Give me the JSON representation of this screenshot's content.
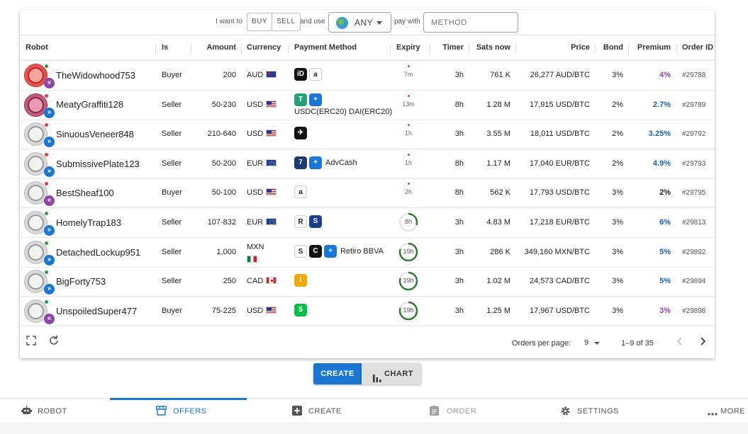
{
  "filter": {
    "want_label": "I want to",
    "buy_label": "BUY",
    "sell_label": "SELL",
    "use_label": "and use",
    "currency_value": "ANY",
    "pay_label": "pay with",
    "method_placeholder": "METHOD"
  },
  "columns": [
    "Robot",
    "Is",
    "Amount",
    "Currency",
    "Payment Method",
    "Expiry",
    "Timer",
    "Sats now",
    "Price",
    "Bond",
    "Premium",
    "Order ID"
  ],
  "rows": [
    {
      "robot": "TheWidowhood753",
      "is": "Buyer",
      "amount": "200",
      "currency": "AUD",
      "flag": "au",
      "avatar": "red",
      "status": "green",
      "side": "buy",
      "methods": [
        {
          "icon": "instant-sepa-icon",
          "color": "#111",
          "glyph": "iD"
        },
        {
          "icon": "amazon-icon",
          "color": "#ffffff",
          "glyph": "a"
        }
      ],
      "method_text": "",
      "expiry": "7m",
      "expiry_type": "text",
      "timer": "3h",
      "sats": "761 K",
      "price": "26,277 AUD/BTC",
      "bond": "3%",
      "premium": "4%",
      "premium_color": "#8e44ad",
      "order_id": "#29788"
    },
    {
      "robot": "MeatyGraffiti128",
      "is": "Seller",
      "amount": "50-230",
      "currency": "USD",
      "flag": "us",
      "avatar": "pink",
      "status": "red",
      "side": "sell",
      "methods": [
        {
          "icon": "tether-icon",
          "color": "#26a17b",
          "glyph": "T"
        },
        {
          "icon": "dai-icon",
          "color": "#1976d2",
          "glyph": "+"
        }
      ],
      "method_text": "USDC(ERC20) DAI(ERC20)",
      "expiry": "13m",
      "expiry_type": "text",
      "timer": "8h",
      "sats": "1.28 M",
      "price": "17,915 USD/BTC",
      "bond": "2%",
      "premium": "2.7%",
      "premium_color": "#1a5fa8",
      "order_id": "#29789"
    },
    {
      "robot": "SinuousVeneer848",
      "is": "Seller",
      "amount": "210-640",
      "currency": "USD",
      "flag": "us",
      "avatar": "gray",
      "status": "red",
      "side": "sell",
      "methods": [
        {
          "icon": "cashapp-icon",
          "color": "#111",
          "glyph": "✈"
        }
      ],
      "method_text": "",
      "expiry": "1h",
      "expiry_type": "text",
      "timer": "3h",
      "sats": "3.55 M",
      "price": "18,011 USD/BTC",
      "bond": "2%",
      "premium": "3.25%",
      "premium_color": "#1a5fa8",
      "order_id": "#29792"
    },
    {
      "robot": "SubmissivePlate123",
      "is": "Seller",
      "amount": "50-200",
      "currency": "EUR",
      "flag": "eu",
      "avatar": "gray",
      "status": "red",
      "side": "sell",
      "methods": [
        {
          "icon": "bizum-icon",
          "color": "#1f3a6e",
          "glyph": "7"
        },
        {
          "icon": "advcash-icon",
          "color": "#1976d2",
          "glyph": "+"
        }
      ],
      "method_text": "AdvCash",
      "expiry": "1h",
      "expiry_type": "text",
      "timer": "8h",
      "sats": "1.17 M",
      "price": "17,040 EUR/BTC",
      "bond": "2%",
      "premium": "4.9%",
      "premium_color": "#1a5fa8",
      "order_id": "#29793"
    },
    {
      "robot": "BestSheaf100",
      "is": "Buyer",
      "amount": "50-100",
      "currency": "USD",
      "flag": "us",
      "avatar": "gray",
      "status": "red",
      "side": "buy",
      "methods": [
        {
          "icon": "amazon-icon",
          "color": "#ffffff",
          "glyph": "a"
        }
      ],
      "method_text": "",
      "expiry": "2h",
      "expiry_type": "text",
      "timer": "8h",
      "sats": "562 K",
      "price": "17,793 USD/BTC",
      "bond": "3%",
      "premium": "2%",
      "premium_color": "#222222",
      "order_id": "#29795"
    },
    {
      "robot": "HomelyTrap183",
      "is": "Seller",
      "amount": "107-832",
      "currency": "EUR",
      "flag": "eu",
      "avatar": "gray",
      "status": "green",
      "side": "sell",
      "methods": [
        {
          "icon": "revolut-icon",
          "color": "#ffffff",
          "glyph": "R"
        },
        {
          "icon": "sepa-icon",
          "color": "#1c3e8f",
          "glyph": "S"
        }
      ],
      "method_text": "",
      "expiry": "8h",
      "expiry_type": "ring",
      "ring_fraction": 0.3,
      "timer": "3h",
      "sats": "4.83 M",
      "price": "17,218 EUR/BTC",
      "bond": "3%",
      "premium": "6%",
      "premium_color": "#1a5fa8",
      "order_id": "#29813"
    },
    {
      "robot": "DetachedLockup951",
      "is": "Seller",
      "amount": "1,000",
      "currency": "MXN",
      "flag": "mx",
      "avatar": "gray",
      "status": "green",
      "side": "sell",
      "methods": [
        {
          "icon": "spei-icon",
          "color": "#ffffff",
          "glyph": "S"
        },
        {
          "icon": "codi-icon",
          "color": "#111",
          "glyph": "C"
        },
        {
          "icon": "retiro-icon",
          "color": "#1976d2",
          "glyph": "+"
        }
      ],
      "method_text": "Retiro BBVA",
      "expiry": "19h",
      "expiry_type": "ring",
      "ring_fraction": 0.8,
      "timer": "3h",
      "sats": "286 K",
      "price": "349,160 MXN/BTC",
      "bond": "3%",
      "premium": "5%",
      "premium_color": "#1a5fa8",
      "order_id": "#29892"
    },
    {
      "robot": "BigForty753",
      "is": "Seller",
      "amount": "250",
      "currency": "CAD",
      "flag": "ca",
      "avatar": "gray",
      "status": "green",
      "side": "sell",
      "methods": [
        {
          "icon": "interac-icon",
          "color": "#f5a800",
          "glyph": "I"
        }
      ],
      "method_text": "",
      "expiry": "19h",
      "expiry_type": "ring",
      "ring_fraction": 0.8,
      "timer": "3h",
      "sats": "1.02 M",
      "price": "24,573 CAD/BTC",
      "bond": "3%",
      "premium": "5%",
      "premium_color": "#1a5fa8",
      "order_id": "#29894"
    },
    {
      "robot": "UnspoiledSuper477",
      "is": "Buyer",
      "amount": "75-225",
      "currency": "USD",
      "flag": "us",
      "avatar": "gray",
      "status": "green",
      "side": "buy",
      "methods": [
        {
          "icon": "cash-app-icon",
          "color": "#00c244",
          "glyph": "$"
        }
      ],
      "method_text": "",
      "expiry": "19h",
      "expiry_type": "ring",
      "ring_fraction": 0.8,
      "timer": "3h",
      "sats": "1.25 M",
      "price": "17,967 USD/BTC",
      "bond": "3%",
      "premium": "3%",
      "premium_color": "#8e44ad",
      "order_id": "#29898"
    }
  ],
  "footer": {
    "per_page_label": "Orders per page:",
    "per_page_value": "9",
    "range": "1–9 of 35"
  },
  "buttons": {
    "create": "CREATE",
    "chart": "CHART"
  },
  "nav": [
    {
      "label": "ROBOT",
      "icon": "robot-icon",
      "active": false
    },
    {
      "label": "OFFERS",
      "icon": "storefront-icon",
      "active": true
    },
    {
      "label": "CREATE",
      "icon": "add-box-icon",
      "active": false
    },
    {
      "label": "ORDER",
      "icon": "assignment-icon",
      "active": false,
      "disabled": true
    },
    {
      "label": "SETTINGS",
      "icon": "gear-icon",
      "active": false
    },
    {
      "label": "MORE",
      "icon": "more-dots-icon",
      "active": false
    }
  ],
  "colors": {
    "accent": "#1976d2",
    "buyer_purple": "#8e44ad",
    "online_green": "#2e9b3c",
    "offline_red": "#e53935",
    "ring_green": "#2e7d32"
  }
}
